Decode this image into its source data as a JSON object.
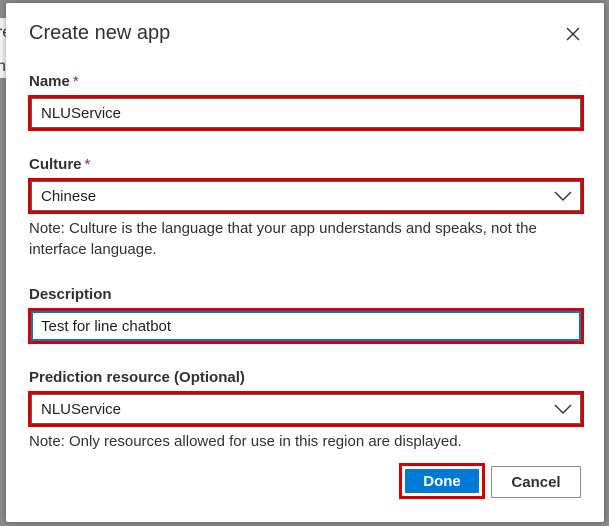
{
  "background": {
    "peek_line1": "re",
    "peek_line2": "h"
  },
  "dialog": {
    "title": "Create new app",
    "close_icon": "close-icon"
  },
  "form": {
    "name": {
      "label": "Name",
      "required_mark": "*",
      "value": "NLUService"
    },
    "culture": {
      "label": "Culture",
      "required_mark": "*",
      "value": "Chinese",
      "note": "Note: Culture is the language that your app understands and speaks, not the interface language."
    },
    "description": {
      "label": "Description",
      "value": "Test for line chatbot"
    },
    "prediction_resource": {
      "label": "Prediction resource (Optional)",
      "value": "NLUService",
      "note": "Note: Only resources allowed for use in this region are displayed."
    }
  },
  "buttons": {
    "done_label": "Done",
    "cancel_label": "Cancel"
  },
  "colors": {
    "accent": "#0078d4",
    "highlight_border": "#d40000",
    "required": "#a4262c"
  }
}
